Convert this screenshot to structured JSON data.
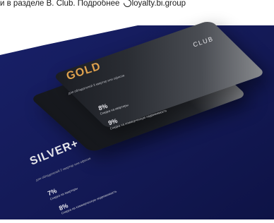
{
  "header": {
    "text_before_link": "и в разделе B. Club. Подробнее ",
    "link_text": "loyalty.bi.group",
    "link_icon": "link-icon"
  },
  "background": {
    "colors": [
      "#141a57",
      "#1c2470",
      "#0f1448"
    ]
  },
  "cards": {
    "gold": {
      "title": "GOLD",
      "brand": "CLUB",
      "subtitle": "для обладателей 3 квартир или офисов",
      "discounts": [
        {
          "value": "8%",
          "label": "Скидка на квартиры"
        },
        {
          "value": "9%",
          "label": "Скидка на коммерческую недвижимость"
        }
      ],
      "title_color": "#e0a24e"
    },
    "silver": {
      "title": "SILVER+",
      "subtitle": "для обладателей 2 квартир или офисов",
      "discounts": [
        {
          "value": "7%",
          "label": "Скидка на квартиры"
        },
        {
          "value": "8%",
          "label": "Скидка на коммерческую недвижимость"
        }
      ],
      "title_color": "#e6e6ea"
    }
  }
}
